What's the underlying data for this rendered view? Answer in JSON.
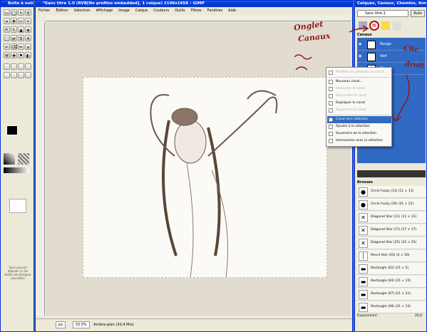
{
  "toolbox": {
    "title": "Boîte à outils",
    "tools": [
      "▭",
      "◯",
      "ϟ",
      "⚲",
      "⌗",
      "✥",
      "✂",
      "⌖",
      "⇱",
      "✎",
      "▲",
      "◈",
      "⬚",
      "⇄",
      "⇅",
      "A",
      "✍",
      "⌫",
      "✏",
      "⌀",
      "⚒",
      "✚",
      "⚑",
      "◐"
    ],
    "note": "Vous pouvez déposer ici les boîtes de dialogue ancrables"
  },
  "main": {
    "title": "*Sans titre 1.0 (RVB[No profiles embedded], 1 calque) 2198x1658 – GIMP",
    "menu": [
      "Fichier",
      "Édition",
      "Sélection",
      "Affichage",
      "Image",
      "Calque",
      "Couleurs",
      "Outils",
      "Filtres",
      "Fenêtres",
      "Aide"
    ],
    "status_unit": "px",
    "status_zoom": "33.3%",
    "status_text": "Arrière-plan (20,4 Mio)"
  },
  "right": {
    "title": "Calques, Canaux, Chemins, Annul...",
    "image_select": "Sans titre-1",
    "auto": "Auto",
    "panel_label": "Canaux",
    "channels": [
      "Rouge",
      "Vert",
      "Bleu"
    ],
    "brushes_label": "Brosses",
    "brushes": [
      "Circle Fuzzy (13) (11 × 11)",
      "Circle Fuzzy (19) (21 × 21)",
      "Diagonal Star (11) (11 × 11)",
      "Diagonal Star (17) (17 × 17)",
      "Diagonal Star (25) (25 × 25)",
      "Pencil Hair (03) (4 × 50)",
      "Rectangle (02) (21 × 5)",
      "Rectangle (04) (21 × 15)",
      "Rectangle (07) (21 × 21)",
      "Rectangle (09) (21 × 13)"
    ],
    "spacing_label": "Espacement :",
    "spacing_value": "20,0"
  },
  "menu": {
    "items": [
      {
        "label": "Modifier les attributs du canal...",
        "dis": true
      },
      {
        "label": "Nouveau canal...",
        "dis": false
      },
      {
        "label": "Remonter le canal",
        "dis": true
      },
      {
        "label": "Descendre le canal",
        "dis": true
      },
      {
        "label": "Dupliquer le canal",
        "dis": false
      },
      {
        "label": "Supprimer le canal",
        "dis": true
      },
      {
        "label": "Canal vers sélection",
        "dis": false,
        "hl": true
      },
      {
        "label": "Ajouter à la sélection",
        "dis": false
      },
      {
        "label": "Soustraire de la sélection",
        "dis": false
      },
      {
        "label": "Intersection avec la sélection",
        "dis": false
      }
    ]
  },
  "annotations": {
    "onglet": "Onglet",
    "canaux": "Canaux",
    "clic": "Clic",
    "droit": "droit"
  }
}
